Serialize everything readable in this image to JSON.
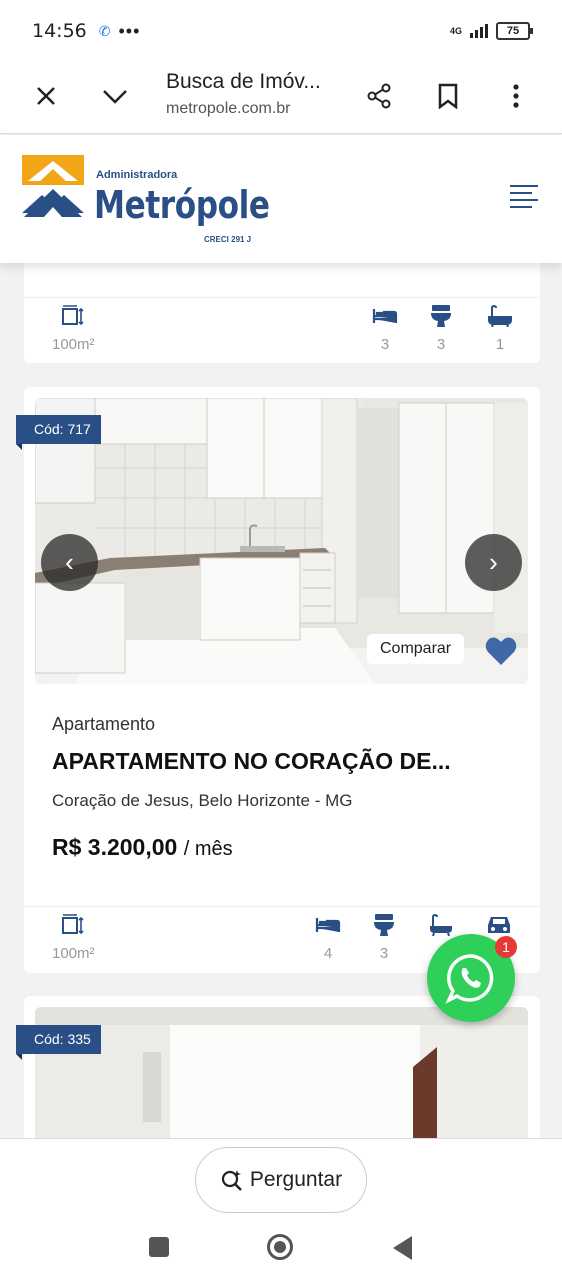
{
  "status": {
    "time": "14:56",
    "network": "4G",
    "battery": "75"
  },
  "browser": {
    "title": "Busca de Imóv...",
    "url": "metropole.com.br"
  },
  "site": {
    "logo_small": "Administradora",
    "logo_brand": "Metrópole",
    "logo_creci": "CRECI 291 J"
  },
  "listings": [
    {
      "area": "100m²",
      "beds": "3",
      "baths": "3",
      "suites": "1"
    },
    {
      "code": "Cód: 717",
      "compare_label": "Comparar",
      "type": "Apartamento",
      "title": "APARTAMENTO NO CORAÇÃO DE...",
      "location": "Coração de Jesus, Belo Horizonte - MG",
      "price": "R$ 3.200,00",
      "price_suffix": "/ mês",
      "area": "100m²",
      "beds": "4",
      "baths": "3"
    },
    {
      "code": "Cód: 335"
    }
  ],
  "whatsapp": {
    "badge": "1"
  },
  "ask_button": {
    "label": "Perguntar"
  }
}
